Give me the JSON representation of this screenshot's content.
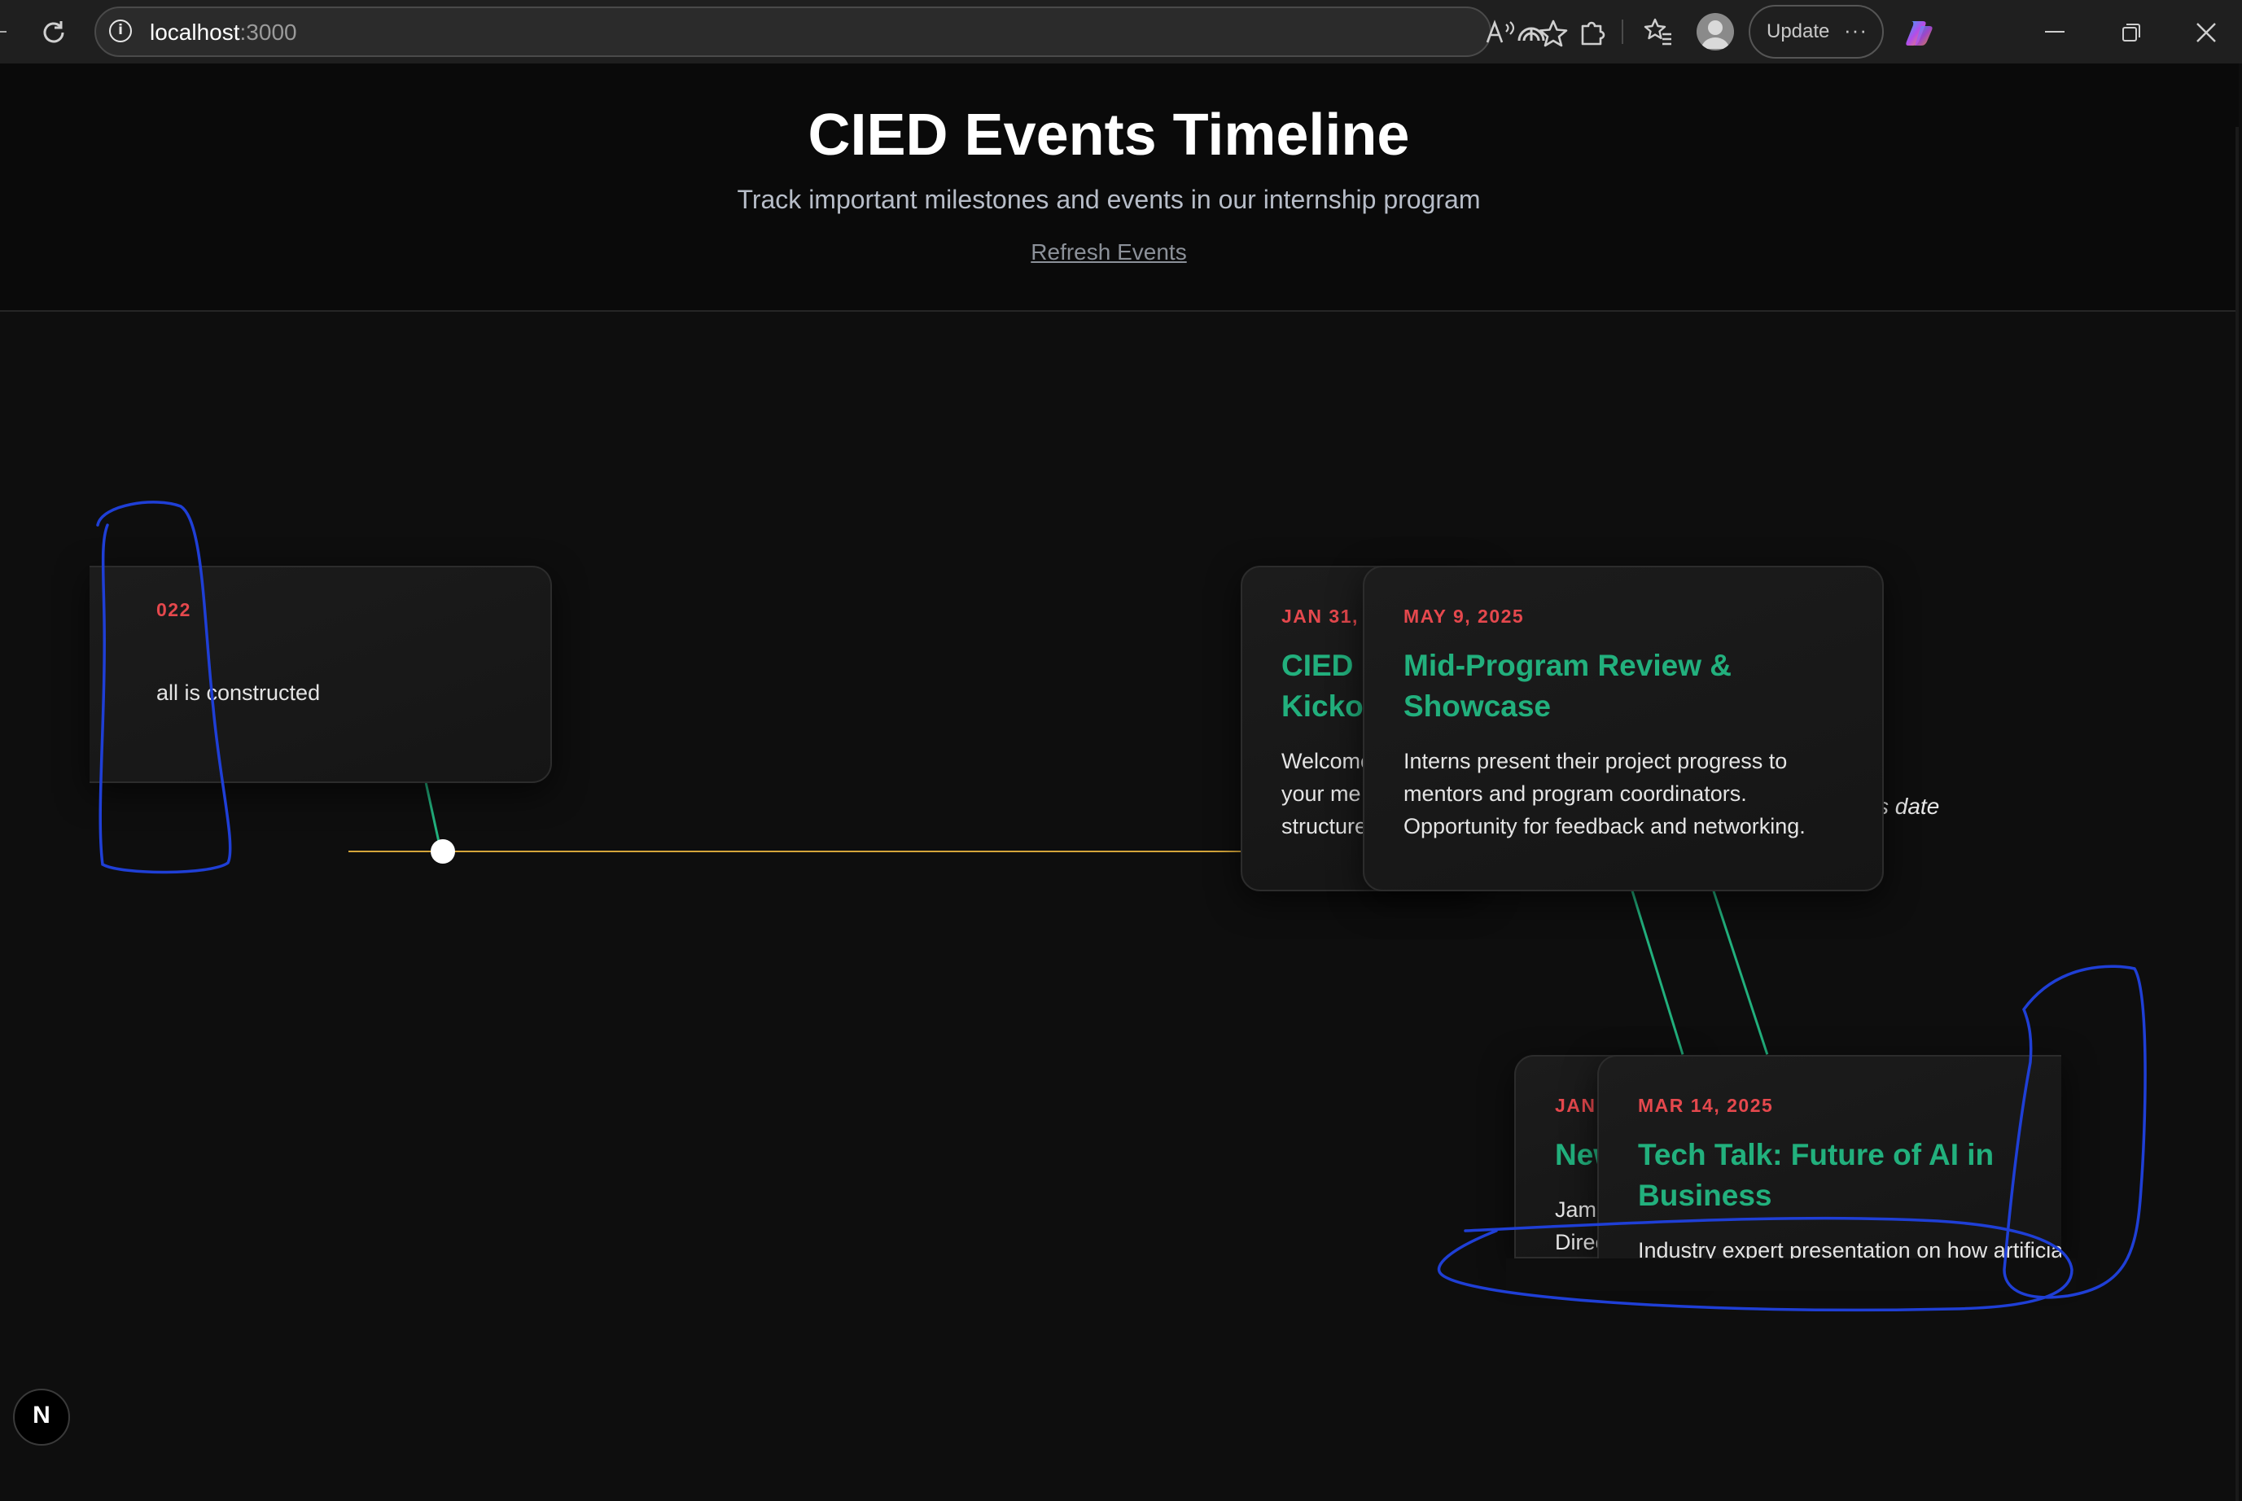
{
  "browser": {
    "url_host": "localhost",
    "url_port": ":3000",
    "update_label": "Update",
    "more_label": "···"
  },
  "header": {
    "title": "CIED Events Timeline",
    "subtitle": "Track important milestones and events in our internship program",
    "refresh_label": "Refresh Events"
  },
  "events": {
    "left_card": {
      "date": "022",
      "description": "all is constructed"
    },
    "jan31": {
      "date": "JAN 31,",
      "title_line1": "CIED",
      "title_line2": "Kicko",
      "desc_line1": "Welcome",
      "desc_line2": "your me",
      "desc_line3": "structure"
    },
    "may9": {
      "date": "MAY 9, 2025",
      "title": "Mid-Program Review & Showcase",
      "description": "Interns present their project progress to mentors and program coordinators. Opportunity for feedback and networking."
    },
    "jan": {
      "date": "JAN",
      "title": "New",
      "desc_line1": "Jame",
      "desc_line2": "Direc"
    },
    "mar14": {
      "date": "MAR 14, 2025",
      "title": "Tech Talk: Future of AI in Business",
      "description": "Industry expert presentation on how artificia"
    },
    "offscreen_text": "s date"
  },
  "badge": {
    "letter": "N"
  },
  "colors": {
    "date": "#e5484d",
    "title": "#22b07d",
    "axis": "#d4a53a",
    "annotation": "#1f3fd6"
  }
}
